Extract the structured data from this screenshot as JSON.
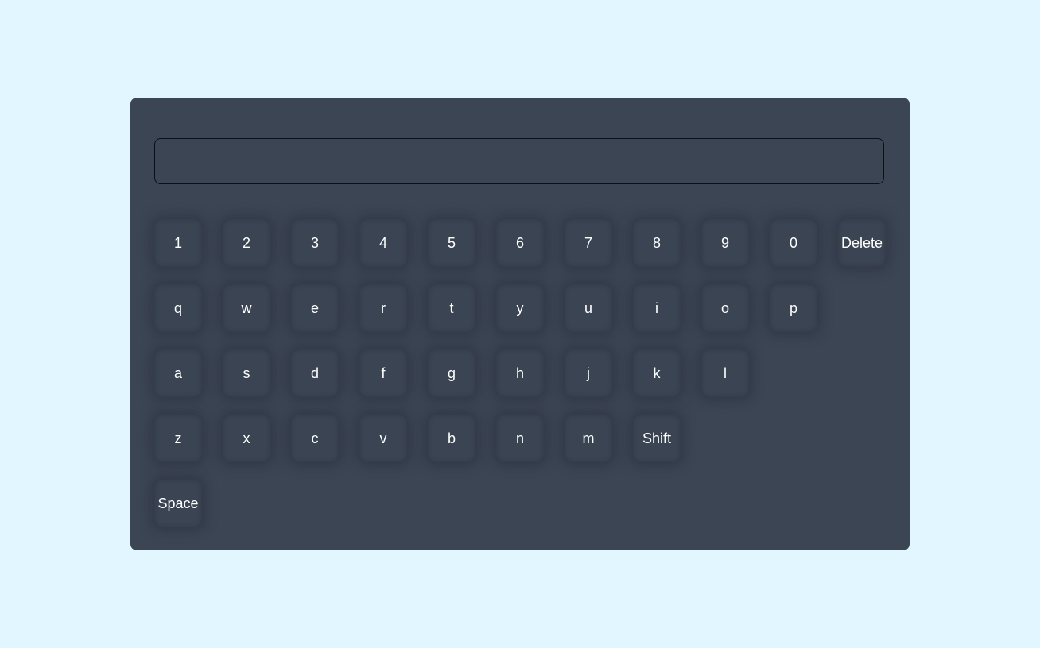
{
  "input": {
    "value": ""
  },
  "keyboard": {
    "row1": [
      "1",
      "2",
      "3",
      "4",
      "5",
      "6",
      "7",
      "8",
      "9",
      "0",
      "Delete"
    ],
    "row2": [
      "q",
      "w",
      "e",
      "r",
      "t",
      "y",
      "u",
      "i",
      "o",
      "p"
    ],
    "row3": [
      "a",
      "s",
      "d",
      "f",
      "g",
      "h",
      "j",
      "k",
      "l"
    ],
    "row4": [
      "z",
      "x",
      "c",
      "v",
      "b",
      "n",
      "m",
      "Shift"
    ],
    "row5": [
      "Space"
    ]
  },
  "colors": {
    "page_background": "#e1f6fe",
    "panel_background": "#3c4554",
    "key_text": "#ffffff"
  }
}
